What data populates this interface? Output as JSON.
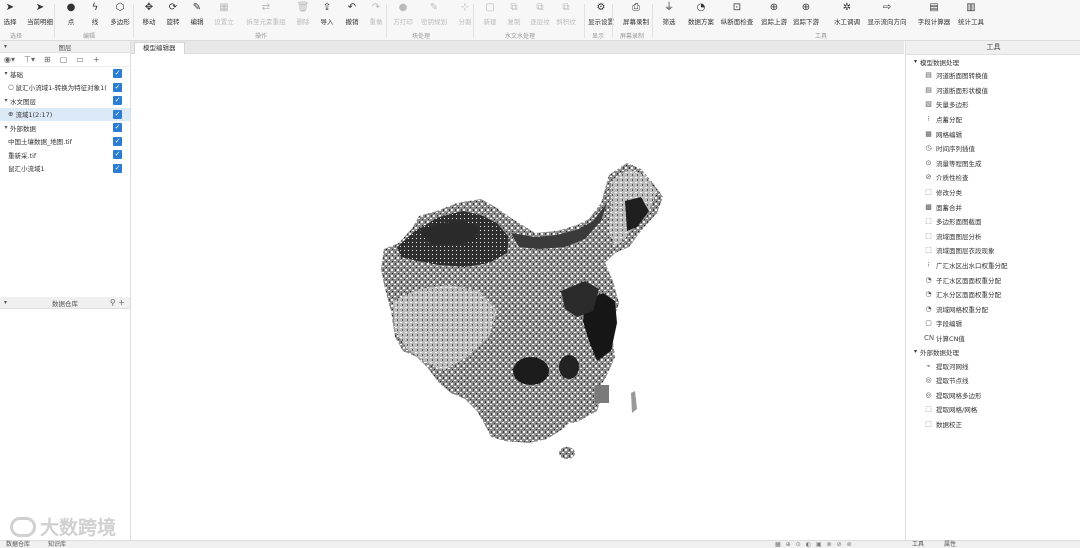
{
  "ribbon": {
    "tools": [
      {
        "id": "select",
        "label": "选择",
        "icon": "arrow-cursor",
        "enabled": true
      },
      {
        "id": "current-select",
        "label": "当前明细",
        "icon": "arrow-cursor-plus",
        "enabled": true
      },
      {
        "id": "point",
        "label": "点",
        "icon": "dot",
        "enabled": true
      },
      {
        "id": "line",
        "label": "线",
        "icon": "zigzag",
        "enabled": true
      },
      {
        "id": "polygon",
        "label": "多边形",
        "icon": "polygon",
        "enabled": true
      },
      {
        "id": "move",
        "label": "移动",
        "icon": "move-cross",
        "enabled": true
      },
      {
        "id": "rotate",
        "label": "旋转",
        "icon": "rotate",
        "enabled": true
      },
      {
        "id": "edit",
        "label": "编辑",
        "icon": "pencil",
        "enabled": true
      },
      {
        "id": "setting",
        "label": "设置立",
        "icon": "grid",
        "enabled": false
      },
      {
        "id": "split-merge",
        "label": "拆至元素重组",
        "icon": "arrows-lr",
        "enabled": false
      },
      {
        "id": "delete",
        "label": "删除",
        "icon": "trash",
        "enabled": false
      },
      {
        "id": "import",
        "label": "导入",
        "icon": "import",
        "enabled": true
      },
      {
        "id": "undo",
        "label": "撤销",
        "icon": "undo",
        "enabled": true
      },
      {
        "id": "redo",
        "label": "重做",
        "icon": "redo",
        "enabled": false
      },
      {
        "id": "print",
        "label": "方打印",
        "icon": "dot",
        "enabled": false
      },
      {
        "id": "edit-compute",
        "label": "密钥规划",
        "icon": "pencil",
        "enabled": false
      },
      {
        "id": "divide",
        "label": "分割",
        "icon": "split",
        "enabled": false
      },
      {
        "id": "new",
        "label": "新建",
        "icon": "page",
        "enabled": false
      },
      {
        "id": "copy",
        "label": "复制",
        "icon": "copy",
        "enabled": false
      },
      {
        "id": "attr1",
        "label": "逐层纹",
        "icon": "copy",
        "enabled": false
      },
      {
        "id": "attr2",
        "label": "斜积纹",
        "icon": "copy",
        "enabled": false
      },
      {
        "id": "display-settings",
        "label": "显示设置",
        "icon": "gear",
        "enabled": true
      },
      {
        "id": "screen-record",
        "label": "屏幕录制",
        "icon": "camera",
        "enabled": true
      },
      {
        "id": "filter",
        "label": "筛选",
        "icon": "funnel",
        "enabled": true
      },
      {
        "id": "data-scheme",
        "label": "数据方案",
        "icon": "pie",
        "enabled": true
      },
      {
        "id": "profile-check",
        "label": "纵断面检查",
        "icon": "profile",
        "enabled": true
      },
      {
        "id": "trace-up",
        "label": "追踪上游",
        "icon": "target-up",
        "enabled": true
      },
      {
        "id": "trace-down",
        "label": "追踪下游",
        "icon": "target-down",
        "enabled": true
      },
      {
        "id": "hydraulic",
        "label": "水工调调",
        "icon": "swirl",
        "enabled": true
      },
      {
        "id": "flow-direction",
        "label": "显示流向方向",
        "icon": "flow",
        "enabled": true
      },
      {
        "id": "field-calculator",
        "label": "字段计算器",
        "icon": "calculator",
        "enabled": true
      },
      {
        "id": "statistics",
        "label": "统计工具",
        "icon": "bar-chart",
        "enabled": true
      }
    ],
    "groups": [
      {
        "label": "选择"
      },
      {
        "label": "编辑"
      },
      {
        "label": "操作"
      },
      {
        "label": "块处理"
      },
      {
        "label": "水文水处理"
      },
      {
        "label": "显示"
      },
      {
        "label": "屏幕录制"
      },
      {
        "label": "工具"
      }
    ]
  },
  "layers_panel": {
    "title": "图层",
    "tree": [
      {
        "label": "基础",
        "level": 0,
        "expanded": true,
        "checked": true,
        "selected": false,
        "sym": ""
      },
      {
        "label": "鼠汇小流域1-转换为特征对象1(",
        "level": 1,
        "checked": true,
        "selected": false,
        "sym": "○"
      },
      {
        "label": "水文图层",
        "level": 0,
        "expanded": true,
        "checked": true,
        "selected": false,
        "sym": ""
      },
      {
        "label": "流域1(2:17)",
        "level": 1,
        "checked": true,
        "selected": true,
        "sym": "⊕"
      },
      {
        "label": "外部数据",
        "level": 0,
        "expanded": true,
        "checked": true,
        "selected": false,
        "sym": ""
      },
      {
        "label": "中国土壤数据_地图.tif",
        "level": 1,
        "checked": true,
        "selected": false,
        "sym": ""
      },
      {
        "label": "重新采.tif",
        "level": 1,
        "checked": true,
        "selected": false,
        "sym": ""
      },
      {
        "label": "鼠汇小流域1",
        "level": 1,
        "checked": true,
        "selected": false,
        "sym": ""
      }
    ]
  },
  "warehouse_panel": {
    "title": "数据仓库"
  },
  "document": {
    "tab_label": "模型编辑器"
  },
  "tools_panel": {
    "title": "工具",
    "categories": [
      {
        "label": "模型数据处理",
        "items": [
          "河道断面图转换值",
          "河道断面形状模值",
          "矢量多边形",
          "点蓄分配",
          "网格编辑",
          "时间序列插值",
          "流量等程图生成",
          "介质性检查",
          "修改分类",
          "面蓄合并",
          "多边形面图截面",
          "流域面图层分析",
          "流域面图层衣段现象",
          "广汇水区出水口权重分配",
          "子汇水区面面权重分配",
          "汇水分区面面权重分配",
          "流域网格权重分配",
          "字段编辑",
          "计算CN值"
        ]
      },
      {
        "label": "外部数据处理",
        "items": [
          "提取河网线",
          "提取节点线",
          "提取网格多边形",
          "提取网格/网格",
          "数据校正"
        ]
      }
    ]
  },
  "status_bar": {
    "tabs": [
      "数据仓库",
      "知识库"
    ],
    "right_tabs": [
      "工具",
      "属性"
    ]
  },
  "watermark": {
    "text": "大数跨境"
  }
}
